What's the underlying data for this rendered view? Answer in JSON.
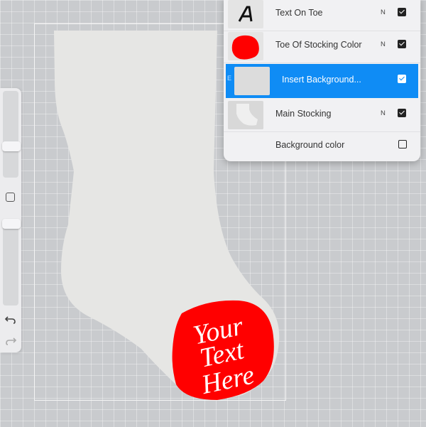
{
  "canvas": {
    "toe_text_lines": [
      "Your",
      "Text",
      "Here"
    ],
    "toe_color": "#ff0000",
    "stocking_color": "#e6e6e4"
  },
  "sidebar": {
    "undo_icon": "undo-icon",
    "redo_icon": "redo-icon"
  },
  "layers": [
    {
      "name": "Text On Toe",
      "blend": "N",
      "visible": true,
      "thumb": "text-layer-icon"
    },
    {
      "name": "Toe Of Stocking Color",
      "blend": "N",
      "visible": true,
      "thumb": "red-shape"
    },
    {
      "name": "Insert Background...",
      "blend": "",
      "visible": true,
      "selected": true,
      "thumb": "blank"
    },
    {
      "name": "Main Stocking",
      "blend": "N",
      "visible": true,
      "thumb": "stocking-shape"
    }
  ],
  "background_layer": {
    "name": "Background color",
    "visible": false
  },
  "colors": {
    "accent": "#0f8cf5",
    "toe": "#ff0000"
  }
}
